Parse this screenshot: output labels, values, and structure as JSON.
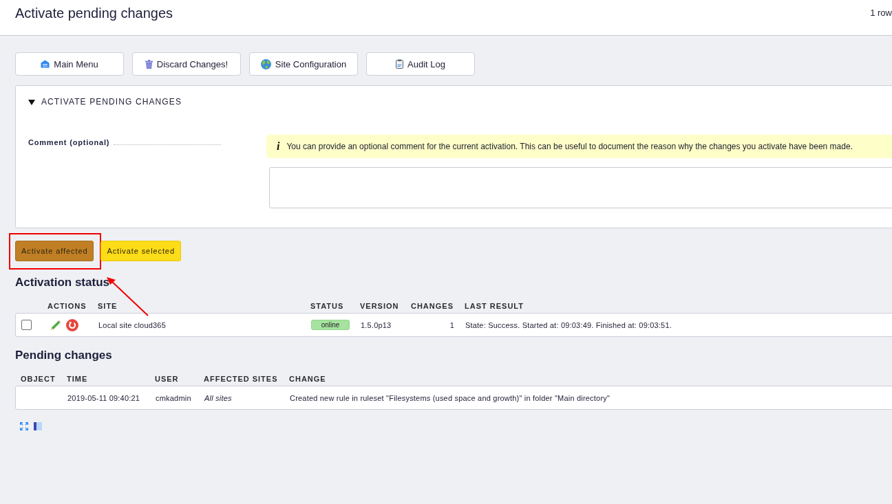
{
  "header": {
    "title": "Activate pending changes",
    "row_count": "1 row"
  },
  "toolbar": [
    {
      "label": "Main Menu",
      "kind": "home"
    },
    {
      "label": "Discard Changes!",
      "kind": "trash"
    },
    {
      "label": "Site Configuration",
      "kind": "globe"
    },
    {
      "label": "Audit Log",
      "kind": "clipboard"
    }
  ],
  "activate_panel": {
    "title": "ACTIVATE PENDING CHANGES",
    "expanded": true,
    "comment_label": "Comment (optional)",
    "help_icon": "i",
    "help_text": "You can provide an optional comment for the current activation. This can be useful to document the reason why the changes you activate have been made."
  },
  "activate_buttons": [
    {
      "label": "Activate affected",
      "kind": "affected",
      "highlighted": true
    },
    {
      "label": "Activate selected",
      "kind": "selected",
      "highlighted": false
    }
  ],
  "activation_status": {
    "title": "Activation status",
    "columns": [
      "ACTIONS",
      "SITE",
      "STATUS",
      "VERSION",
      "CHANGES",
      "LAST RESULT"
    ],
    "rows": [
      {
        "checked": false,
        "site": "Local site cloud365",
        "status": "online",
        "version": "1.5.0p13",
        "changes": "1",
        "last_result": "State: Success. Started at: 09:03:49. Finished at: 09:03:51."
      }
    ]
  },
  "pending_changes": {
    "title": "Pending changes",
    "columns": [
      "OBJECT",
      "TIME",
      "USER",
      "AFFECTED SITES",
      "CHANGE"
    ],
    "rows": [
      {
        "time": "2019-05-11 09:40:21",
        "user": "cmkadmin",
        "affected_sites": "All sites",
        "change": "Created new rule in ruleset \"Filesystems (used space and growth)\" in folder \"Main directory\""
      }
    ]
  }
}
